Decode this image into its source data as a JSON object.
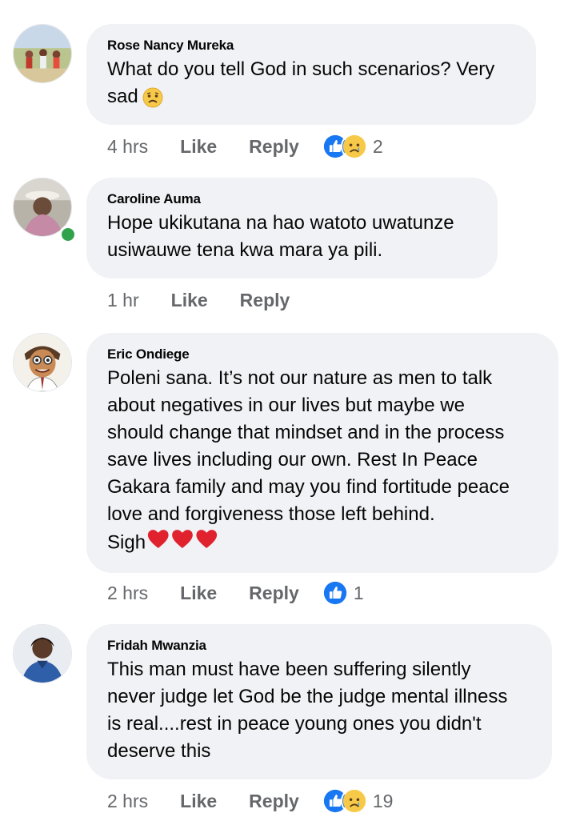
{
  "colors": {
    "bubble": "#f0f2f5",
    "meta": "#65676b",
    "like_blue": "#1877f2",
    "online": "#31a24c"
  },
  "actions": {
    "like": "Like",
    "reply": "Reply"
  },
  "comments": [
    {
      "author": "Rose Nancy Mureka",
      "text": "What do you tell God in such scenarios? Very\nsad",
      "inline_emoji": "sad-face-emoji",
      "time": "4 hrs",
      "reactions": [
        "like-reaction-icon",
        "sad-reaction-icon"
      ],
      "reaction_count": "2"
    },
    {
      "author": "Caroline Auma",
      "text": "Hope ukikutana na hao watoto uwatunze\nusiwauwe tena kwa mara ya pili.",
      "online": true,
      "time": "1 hr"
    },
    {
      "author": "Eric Ondiege",
      "text": "Poleni sana. It’s not our nature as men to talk\nabout negatives in our lives but maybe we\nshould change that mindset and in the process\nsave lives including our own. Rest In Peace\nGakara family and may you find fortitude peace\nlove and forgiveness those left behind.\nSigh",
      "inline_emoji": "three-red-hearts",
      "time": "2 hrs",
      "reactions": [
        "like-reaction-icon"
      ],
      "reaction_count": "1"
    },
    {
      "author": "Fridah Mwanzia",
      "text": "This man must have been suffering silently\nnever judge let God be the judge mental illness\nis real....rest in peace young ones you didn't\ndeserve this",
      "time": "2 hrs",
      "reactions": [
        "like-reaction-icon",
        "sad-reaction-icon"
      ],
      "reaction_count": "19"
    }
  ]
}
